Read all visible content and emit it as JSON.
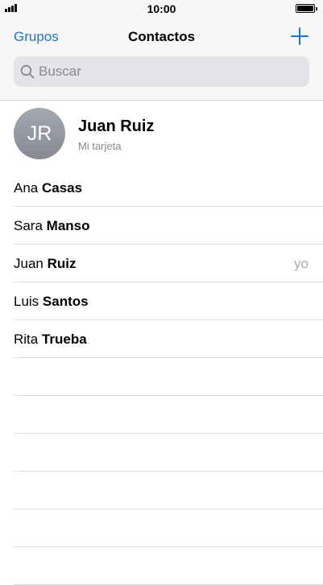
{
  "status_bar": {
    "time": "10:00",
    "battery_level": 1.0,
    "signal_bars": 4
  },
  "nav": {
    "left_label": "Grupos",
    "title": "Contactos",
    "add_icon": "plus-icon"
  },
  "search": {
    "placeholder": "Buscar",
    "icon": "search-icon"
  },
  "my_card": {
    "initials": "JR",
    "name": "Juan Ruiz",
    "subtitle": "Mi tarjeta"
  },
  "contacts": [
    {
      "first": "Ana",
      "last": "Casas",
      "tag": ""
    },
    {
      "first": "Sara",
      "last": "Manso",
      "tag": ""
    },
    {
      "first": "Juan",
      "last": "Ruiz",
      "tag": "yo"
    },
    {
      "first": "Luis",
      "last": "Santos",
      "tag": ""
    },
    {
      "first": "Rita",
      "last": "Trueba",
      "tag": ""
    }
  ],
  "colors": {
    "accent": "#1976d2",
    "secondary_text": "#8a8a8e"
  }
}
